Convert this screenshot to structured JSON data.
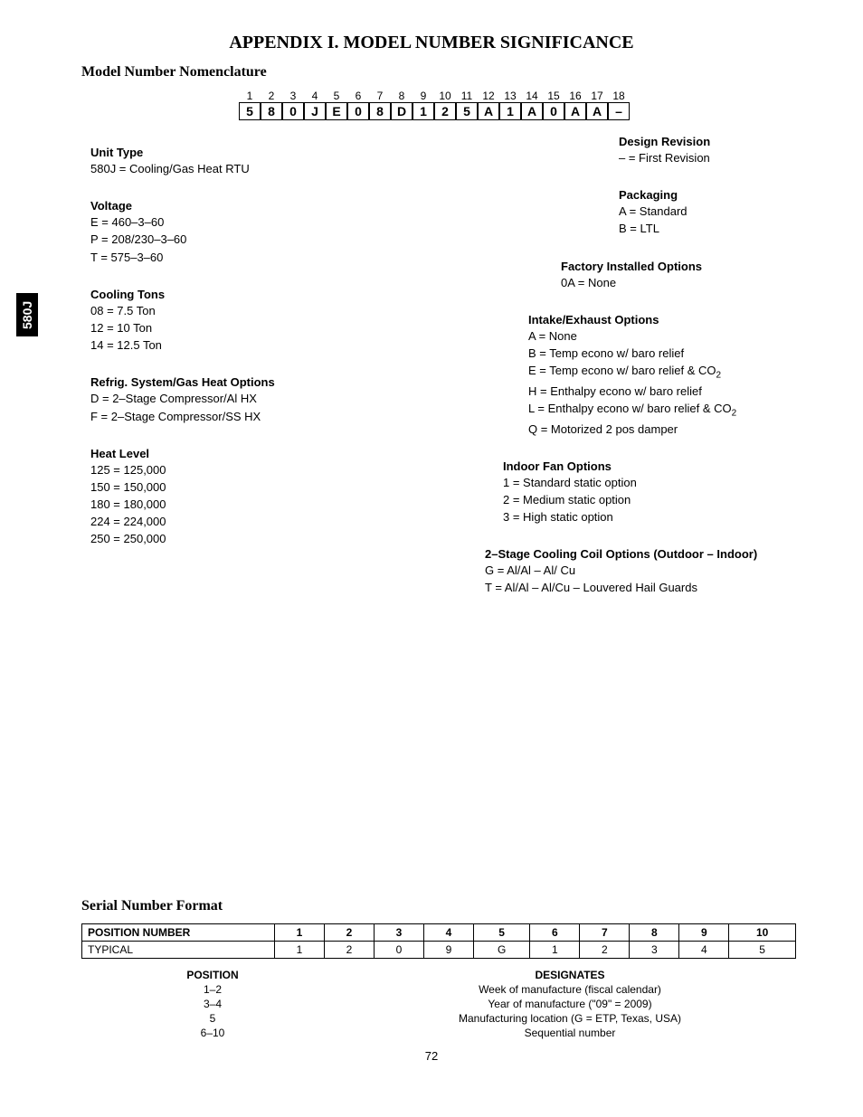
{
  "sideTab": "580J",
  "title": "APPENDIX I. MODEL NUMBER SIGNIFICANCE",
  "subtitle1": "Model Number Nomenclature",
  "positions": [
    "1",
    "2",
    "3",
    "4",
    "5",
    "6",
    "7",
    "8",
    "9",
    "10",
    "11",
    "12",
    "13",
    "14",
    "15",
    "16",
    "17",
    "18"
  ],
  "chars": [
    "5",
    "8",
    "0",
    "J",
    "E",
    "0",
    "8",
    "D",
    "1",
    "2",
    "5",
    "A",
    "1",
    "A",
    "0",
    "A",
    "A",
    "–"
  ],
  "left": {
    "unitType": {
      "title": "Unit Type",
      "items": [
        "580J = Cooling/Gas Heat RTU"
      ]
    },
    "voltage": {
      "title": "Voltage",
      "items": [
        "E = 460–3–60",
        "P = 208/230–3–60",
        "T = 575–3–60"
      ]
    },
    "coolingTons": {
      "title": "Cooling Tons",
      "items": [
        "08 = 7.5 Ton",
        "12 = 10 Ton",
        "14 = 12.5 Ton"
      ]
    },
    "refrig": {
      "title": "Refrig. System/Gas Heat Options",
      "items": [
        "D = 2–Stage Compressor/Al HX",
        "F = 2–Stage Compressor/SS HX"
      ]
    },
    "heatLevel": {
      "title": "Heat Level",
      "items": [
        "125 = 125,000",
        "150 = 150,000",
        "180 = 180,000",
        "224 = 224,000",
        "250 = 250,000"
      ]
    }
  },
  "right": {
    "designRev": {
      "title": "Design Revision",
      "items": [
        "– = First Revision"
      ]
    },
    "packaging": {
      "title": "Packaging",
      "items": [
        "A = Standard",
        "B = LTL"
      ]
    },
    "factory": {
      "title": "Factory Installed Options",
      "items": [
        "0A = None"
      ]
    },
    "intake": {
      "title": "Intake/Exhaust Options",
      "items": [
        "A = None",
        "B = Temp econo w/ baro relief"
      ],
      "special1": "E = Temp econo w/ baro relief & CO",
      "items2": [
        "H = Enthalpy econo w/ baro relief"
      ],
      "special2": "L = Enthalpy econo w/ baro relief & CO",
      "items3": [
        "Q = Motorized 2 pos damper"
      ]
    },
    "indoorFan": {
      "title": "Indoor Fan Options",
      "items": [
        "1 = Standard static option",
        "2 = Medium static option",
        "3 = High static option"
      ]
    },
    "coilOptions": {
      "title": "2–Stage Cooling Coil Options (Outdoor – Indoor)",
      "items": [
        "G = Al/Al – Al/ Cu",
        "T = Al/Al – Al/Cu – Louvered Hail Guards"
      ]
    }
  },
  "subtitle2": "Serial Number Format",
  "serialTable": {
    "row1": {
      "label": "POSITION NUMBER",
      "cells": [
        "1",
        "2",
        "3",
        "4",
        "5",
        "6",
        "7",
        "8",
        "9",
        "10"
      ]
    },
    "row2": {
      "label": "TYPICAL",
      "cells": [
        "1",
        "2",
        "0",
        "9",
        "G",
        "1",
        "2",
        "3",
        "4",
        "5"
      ]
    }
  },
  "designates": {
    "head_l": "POSITION",
    "head_r": "DESIGNATES",
    "rows": [
      {
        "l": "1–2",
        "r": "Week of manufacture (fiscal calendar)"
      },
      {
        "l": "3–4",
        "r": "Year of manufacture (\"09\" = 2009)"
      },
      {
        "l": "5",
        "r": "Manufacturing location (G = ETP, Texas, USA)"
      },
      {
        "l": "6–10",
        "r": "Sequential number"
      }
    ]
  },
  "pageNumber": "72"
}
